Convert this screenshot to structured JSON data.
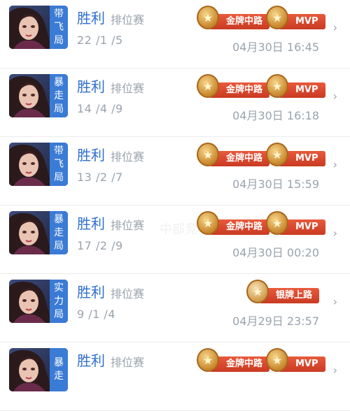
{
  "matches": [
    {
      "mode_tag": [
        "带",
        "飞",
        "局"
      ],
      "result": "胜利",
      "mode": "排位赛",
      "kda": "22 /1 /5",
      "time": "04月30日 16:45",
      "badges": [
        "gold",
        "mvp"
      ],
      "gold_label": "金牌中路",
      "mvp_label": "MVP"
    },
    {
      "mode_tag": [
        "暴",
        "走",
        "局"
      ],
      "result": "胜利",
      "mode": "排位赛",
      "kda": "14 /4 /9",
      "time": "04月30日 16:18",
      "badges": [
        "gold",
        "mvp"
      ],
      "gold_label": "金牌中路",
      "mvp_label": "MVP"
    },
    {
      "mode_tag": [
        "带",
        "飞",
        "局"
      ],
      "result": "胜利",
      "mode": "排位赛",
      "kda": "13 /2 /7",
      "time": "04月30日 15:59",
      "badges": [
        "gold",
        "mvp"
      ],
      "gold_label": "金牌中路",
      "mvp_label": "MVP"
    },
    {
      "mode_tag": [
        "暴",
        "走",
        "局"
      ],
      "result": "胜利",
      "mode": "排位赛",
      "kda": "17 /2 /9",
      "time": "04月30日 00:20",
      "badges": [
        "gold",
        "mvp"
      ],
      "gold_label": "金牌中路",
      "mvp_label": "MVP",
      "watermark": "中部竞"
    },
    {
      "mode_tag": [
        "实",
        "力",
        "局"
      ],
      "result": "胜利",
      "mode": "排位赛",
      "kda": "9 /1 /4",
      "time": "04月29日 23:57",
      "badges": [
        "silver"
      ],
      "silver_label": "银牌上路"
    },
    {
      "mode_tag": [
        "暴",
        "走"
      ],
      "result": "胜利",
      "mode": "排位赛",
      "kda": "",
      "time": "",
      "badges": [
        "gold",
        "mvp"
      ],
      "gold_label": "金牌中路",
      "mvp_label": "MVP"
    }
  ],
  "icons": {
    "chevron": "chevron-right-icon",
    "medal": "medal-icon",
    "avatar": "hero-avatar"
  }
}
